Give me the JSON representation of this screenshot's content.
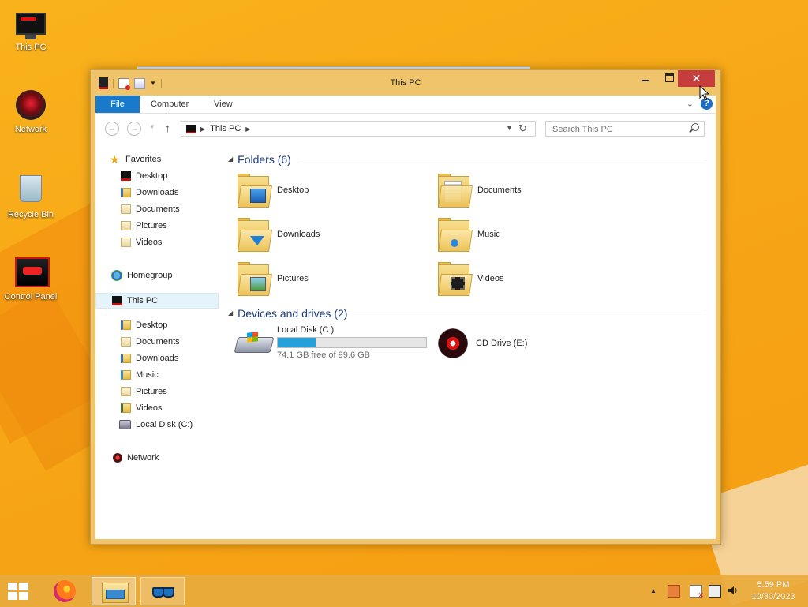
{
  "desktop": {
    "icons": [
      {
        "label": "This PC",
        "icon": "this-pc-icon"
      },
      {
        "label": "Network",
        "icon": "network-icon"
      },
      {
        "label": "Recycle Bin",
        "icon": "recycle-bin-icon"
      },
      {
        "label": "Control Panel",
        "icon": "control-panel-icon"
      }
    ]
  },
  "window": {
    "title": "This PC",
    "close_symbol": "✕",
    "tabs": {
      "file": "File",
      "computer": "Computer",
      "view": "View"
    },
    "help_symbol": "?",
    "ribbon_caret": "⌄"
  },
  "navigation": {
    "back": "←",
    "forward": "→",
    "up": "↑",
    "address": "This PC",
    "refresh": "↻",
    "search_placeholder": "Search This PC"
  },
  "sidebar": {
    "favorites": "Favorites",
    "favorite_items": [
      "Desktop",
      "Downloads",
      "Documents",
      "Pictures",
      "Videos"
    ],
    "homegroup": "Homegroup",
    "this_pc": "This PC",
    "this_pc_items": [
      "Desktop",
      "Documents",
      "Downloads",
      "Music",
      "Pictures",
      "Videos",
      "Local Disk (C:)"
    ],
    "network": "Network"
  },
  "main": {
    "folders_header": "Folders (6)",
    "folders": [
      "Desktop",
      "Documents",
      "Downloads",
      "Music",
      "Pictures",
      "Videos"
    ],
    "devices_header": "Devices and drives (2)",
    "drives": [
      {
        "name": "Local Disk (C:)",
        "free_text": "74.1 GB free of 99.6 GB",
        "used_fraction": 0.256
      },
      {
        "name": "CD Drive (E:)"
      }
    ]
  },
  "taskbar": {
    "time": "5:59 PM",
    "date": "10/30/2023",
    "tray_expand": "▲"
  },
  "colors": {
    "accent": "#1979ca",
    "close_button": "#c73c3c",
    "window_frame": "#efc46a",
    "progress": "#26a0da"
  }
}
